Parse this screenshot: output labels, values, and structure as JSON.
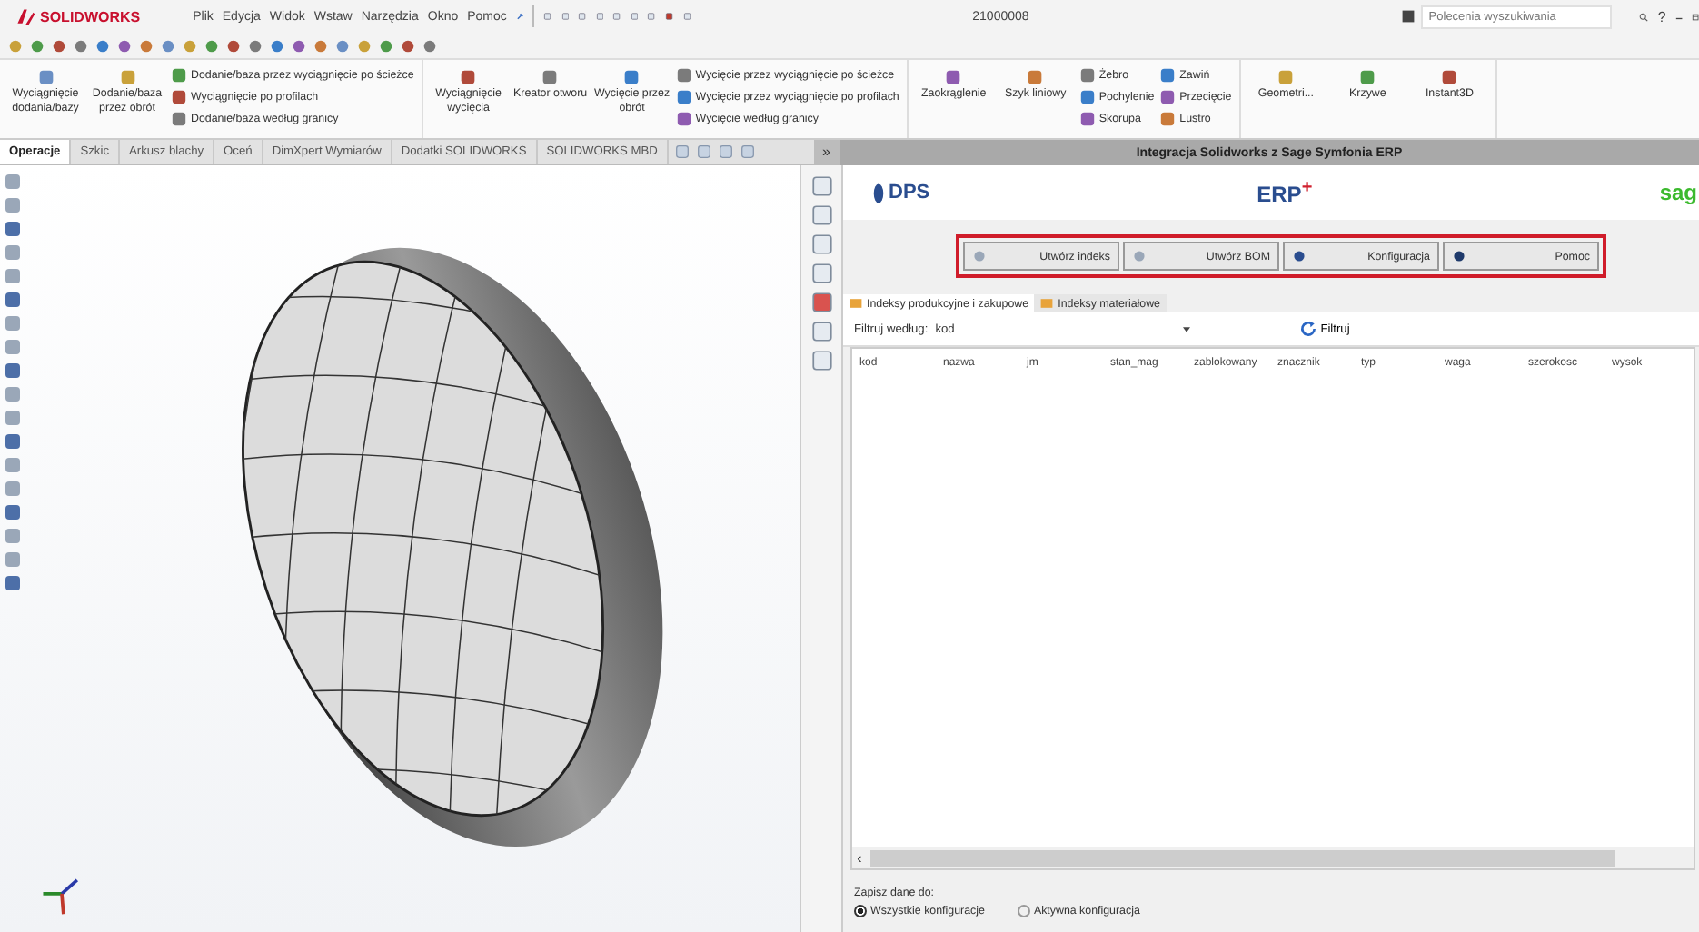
{
  "app": {
    "logo": "SOLIDWORKS",
    "menu": [
      "Plik",
      "Edycja",
      "Widok",
      "Wstaw",
      "Narzędzia",
      "Okno",
      "Pomoc"
    ],
    "document_title": "21000008",
    "search": {
      "placeholder": "Polecenia wyszukiwania"
    },
    "help": "?"
  },
  "ribbon": [
    {
      "items": [
        {
          "kind": "large",
          "label": "Wyciągnięcie dodania/bazy"
        },
        {
          "kind": "large",
          "label": "Dodanie/baza przez obrót"
        },
        {
          "kind": "stack",
          "labels": [
            "Dodanie/baza przez wyciągnięcie po ścieżce",
            "Wyciągnięcie po profilach",
            "Dodanie/baza według granicy"
          ]
        }
      ]
    },
    {
      "items": [
        {
          "kind": "large",
          "label": "Wyciągnięcie wycięcia"
        },
        {
          "kind": "large",
          "label": "Kreator otworu"
        },
        {
          "kind": "large",
          "label": "Wycięcie przez obrót"
        },
        {
          "kind": "stack",
          "labels": [
            "Wycięcie przez wyciągnięcie po ścieżce",
            "Wycięcie przez wyciągnięcie po profilach",
            "Wycięcie według granicy"
          ]
        }
      ]
    },
    {
      "items": [
        {
          "kind": "large",
          "label": "Zaokrąglenie"
        },
        {
          "kind": "large",
          "label": "Szyk liniowy"
        },
        {
          "kind": "stack",
          "labels": [
            "Żebro",
            "Pochylenie",
            "Skorupa"
          ]
        },
        {
          "kind": "stack",
          "labels": [
            "Zawiń",
            "Przecięcie",
            "Lustro"
          ]
        }
      ]
    },
    {
      "items": [
        {
          "kind": "large",
          "label": "Geometri..."
        },
        {
          "kind": "large",
          "label": "Krzywe"
        },
        {
          "kind": "large",
          "label": "Instant3D"
        }
      ]
    }
  ],
  "tabs": [
    {
      "label": "Operacje",
      "selected": true
    },
    {
      "label": "Szkic",
      "selected": false
    },
    {
      "label": "Arkusz blachy",
      "selected": false
    },
    {
      "label": "Oceń",
      "selected": false
    },
    {
      "label": "DimXpert Wymiarów",
      "selected": false
    },
    {
      "label": "Dodatki SOLIDWORKS",
      "selected": false
    },
    {
      "label": "SOLIDWORKS MBD",
      "selected": false
    }
  ],
  "tabs_more": "»",
  "panel": {
    "title": "Integracja Solidworks z Sage Symfonia ERP",
    "logos": {
      "left": "DPS",
      "center": "ERP",
      "center_mark": "+",
      "right": "sag"
    },
    "buttons": [
      "Utwórz indeks",
      "Utwórz BOM",
      "Konfiguracja",
      "Pomoc"
    ],
    "tabs": [
      {
        "label": "Indeksy produkcyjne i zakupowe",
        "selected": true
      },
      {
        "label": "Indeksy materiałowe",
        "selected": false
      }
    ],
    "filter": {
      "label": "Filtruj według:",
      "value": "kod",
      "button": "Filtruj"
    },
    "table": {
      "columns": [
        "kod",
        "nazwa",
        "jm",
        "stan_mag",
        "zablokowany",
        "znacznik",
        "typ",
        "waga",
        "szerokosc",
        "wysok"
      ]
    },
    "scroll_left": "‹",
    "save": {
      "label": "Zapisz dane do:",
      "options": [
        {
          "label": "Wszystkie konfiguracje",
          "selected": true
        },
        {
          "label": "Aktywna konfiguracja",
          "selected": false
        }
      ]
    }
  }
}
